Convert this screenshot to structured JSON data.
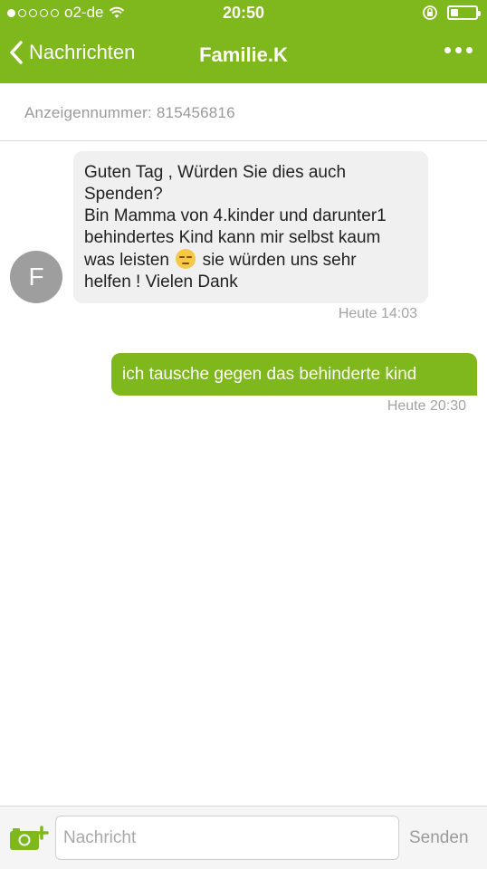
{
  "status_bar": {
    "carrier": "o2-de",
    "time": "20:50",
    "signal_strength": 1,
    "battery_level": 0.3
  },
  "nav": {
    "back_label": "Nachrichten",
    "title": "Familie.K",
    "more_icon": "more-dots-icon"
  },
  "ad": {
    "text": "Anzeigennummer: 815456816"
  },
  "messages": [
    {
      "direction": "incoming",
      "avatar_letter": "F",
      "lines": [
        "Guten Tag , Würden Sie dies auch",
        "Spenden?",
        "Bin Mamma von 4.kinder und darunter1",
        "behindertes Kind kann mir selbst kaum"
      ],
      "line5_before": "was leisten",
      "line5_after": "sie würden uns sehr",
      "line6": "helfen ! Vielen Dank",
      "emoji": "pensive-face",
      "timestamp": "Heute 14:03"
    },
    {
      "direction": "outgoing",
      "text": "ich tausche gegen das behinderte kind",
      "timestamp": "Heute 20:30"
    }
  ],
  "composer": {
    "placeholder": "Nachricht",
    "value": "",
    "send_label": "Senden",
    "camera_icon": "camera-add-icon"
  },
  "colors": {
    "brand_green": "#7fb81c",
    "incoming_bubble": "#f0f0f0",
    "avatar_gray": "#9e9e9e"
  }
}
